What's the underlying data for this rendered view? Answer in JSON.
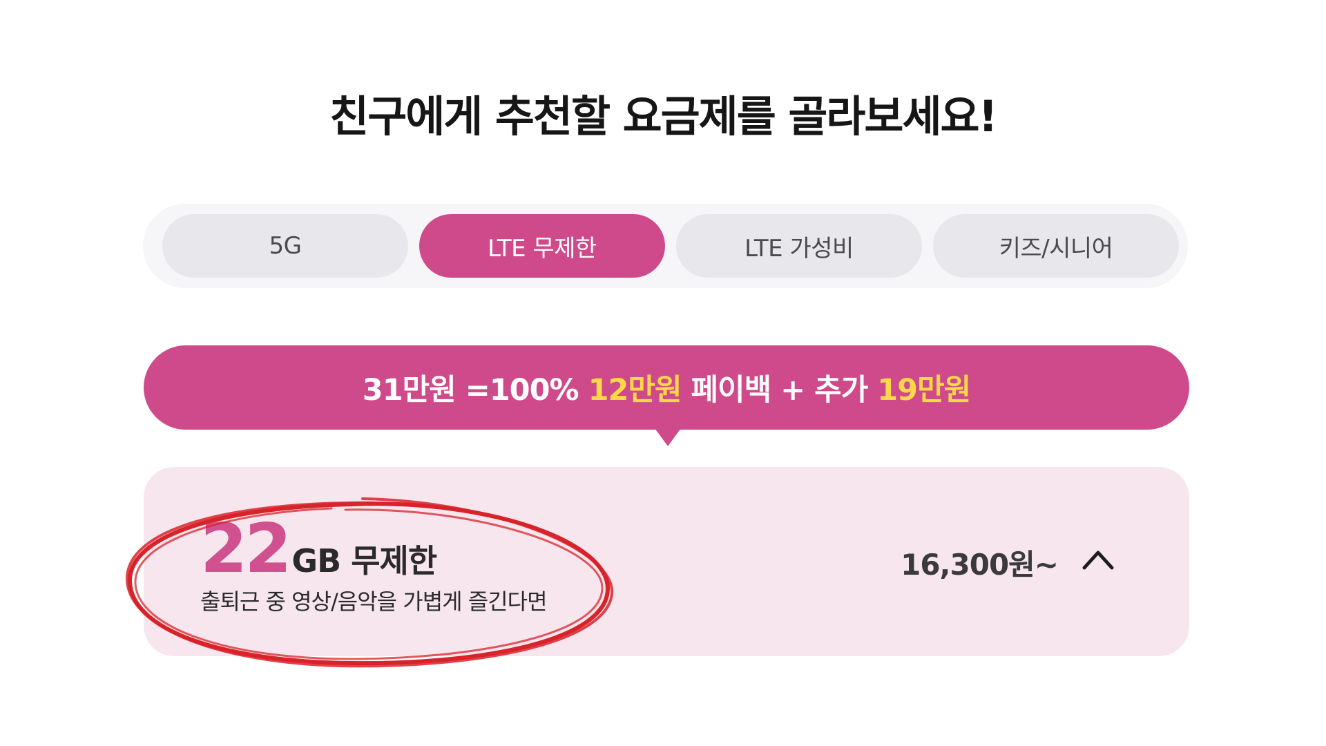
{
  "title": "친구에게 추천할 요금제를 골라보세요!",
  "tabs": [
    {
      "label": "5G",
      "active": false
    },
    {
      "label": "LTE 무제한",
      "active": true
    },
    {
      "label": "LTE 가성비",
      "active": false
    },
    {
      "label": "키즈/시니어",
      "active": false
    }
  ],
  "banner": {
    "part1": "31만원 =100% ",
    "highlight1": "12만원",
    "part2": " 페이백 + 추가 ",
    "highlight2": "19만원"
  },
  "plan": {
    "data_amount": "22",
    "data_unit": "GB 무제한",
    "description": "출퇴근 중 영상/음악을 가볍게 즐긴다면",
    "price": "16,300원~"
  },
  "colors": {
    "accent": "#cf4a8a",
    "highlight": "#ffd84a",
    "card_bg": "#f8e6ef",
    "annotation": "#d8232a"
  },
  "icons": {
    "expand": "chevron-up-icon"
  }
}
